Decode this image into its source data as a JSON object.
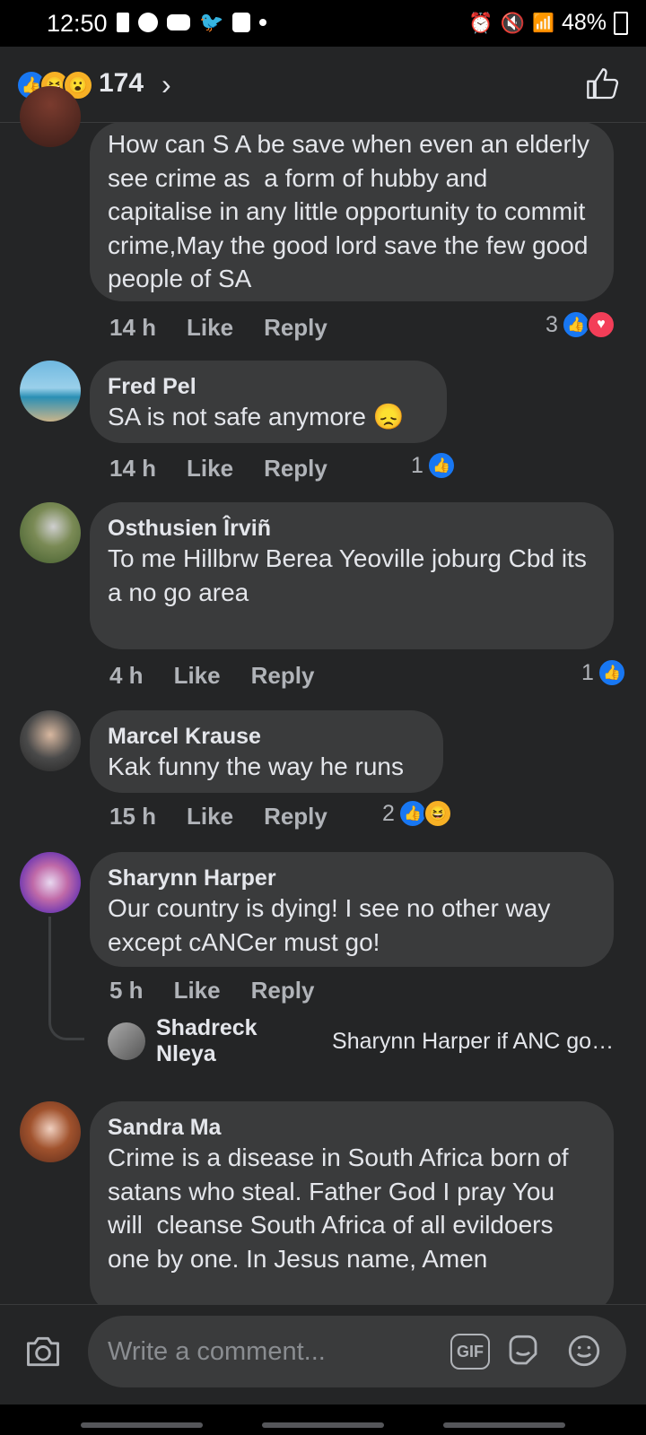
{
  "status_bar": {
    "time": "12:50",
    "battery": "48%"
  },
  "header": {
    "reaction_count": "174",
    "chevron": "›"
  },
  "comments": [
    {
      "name": "",
      "text": "How can S A be save when even an elderly see crime as  a form of hubby and capitalise in any little opportunity to commit crime,May the good lord save the few good people of SA",
      "time": "14 h",
      "like": "Like",
      "reply": "Reply",
      "reactions": "3"
    },
    {
      "name": "Fred Pel",
      "text": "SA is not safe anymore 😞",
      "time": "14 h",
      "like": "Like",
      "reply": "Reply",
      "reactions": "1"
    },
    {
      "name": "Osthusien Îrviñ",
      "text": "To me Hillbrw Berea Yeoville joburg Cbd its a no go area",
      "time": "4 h",
      "like": "Like",
      "reply": "Reply",
      "reactions": "1"
    },
    {
      "name": "Marcel Krause",
      "text": "Kak funny the way he runs",
      "time": "15 h",
      "like": "Like",
      "reply": "Reply",
      "reactions": "2"
    },
    {
      "name": "Sharynn Harper",
      "text": "Our country is dying! I see no other way except cANCer must go!",
      "time": "5 h",
      "like": "Like",
      "reply": "Reply",
      "reactions": ""
    },
    {
      "name": "Sandra Ma",
      "text": "Crime is a disease in South Africa born of satans who steal. Father God I pray You will  cleanse South Africa of all evildoers one by one. In Jesus name, Amen",
      "time": "",
      "like": "",
      "reply": "",
      "reactions": ""
    }
  ],
  "reply_preview": {
    "name": "Shadreck Nleya",
    "text": "Sharynn Harper if ANC goe..."
  },
  "composer": {
    "placeholder": "Write a comment...",
    "gif_label": "GIF"
  },
  "colors": {
    "background": "#242526",
    "bubble": "#3a3b3c",
    "like_blue": "#1877f2",
    "love_red": "#f33e58",
    "haha_yellow": "#f7b125"
  }
}
